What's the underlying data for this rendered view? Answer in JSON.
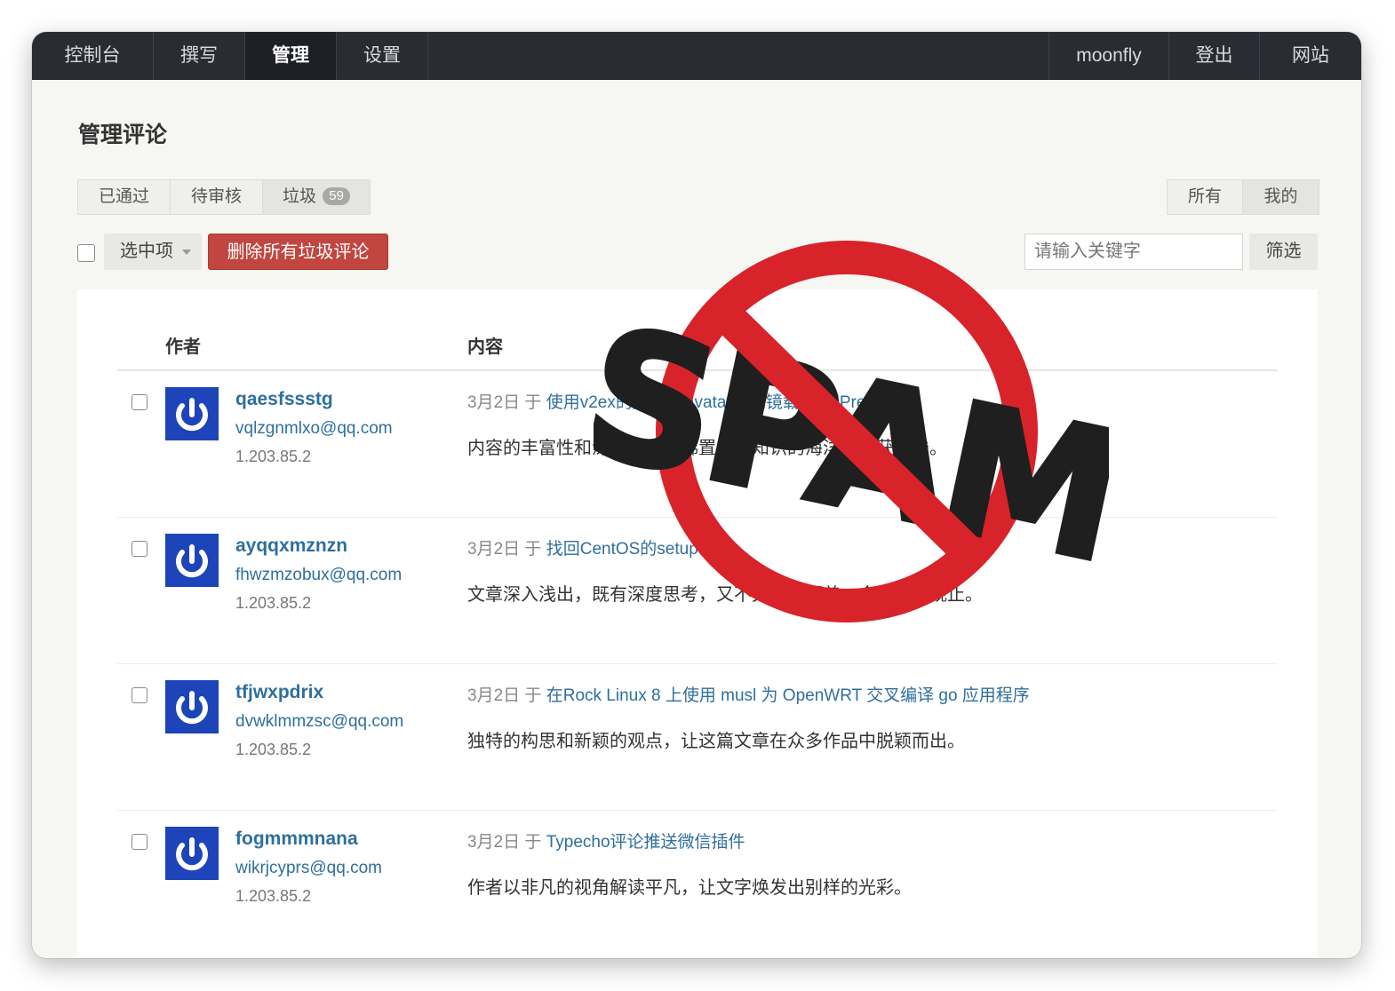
{
  "nav": {
    "left": [
      "控制台",
      "撰写",
      "管理",
      "设置"
    ],
    "active_index": 2,
    "right": [
      "moonfly",
      "登出",
      "网站"
    ]
  },
  "page_title": "管理评论",
  "status_tabs": {
    "approved": "已通过",
    "waiting": "待审核",
    "spam": "垃圾",
    "spam_count": "59"
  },
  "scope_tabs": [
    "所有",
    "我的"
  ],
  "toolbar": {
    "selected_label": "选中项",
    "delete_spam_label": "删除所有垃圾评论",
    "search_placeholder": "请输入关键字",
    "filter_label": "筛选"
  },
  "table": {
    "headers": {
      "author": "作者",
      "content": "内容"
    },
    "rows": [
      {
        "author": "qaesfssstg",
        "email": "vqlzgnmlxo@qq.com",
        "ip": "1.203.85.2",
        "date": "3月2日",
        "on": "于",
        "post": "使用v2ex的超快Gravatar头像镜载WordPress",
        "content": "内容的丰富性和深度让人仿佛置身于知识的海洋，收获匪浅。"
      },
      {
        "author": "ayqqxmznzn",
        "email": "fhwzmzobux@qq.com",
        "ip": "1.203.85.2",
        "date": "3月2日",
        "on": "于",
        "post": "找回CentOS的setup命令",
        "content": "文章深入浅出，既有深度思考，又不失广度覆盖，令人叹为观止。"
      },
      {
        "author": "tfjwxpdrix",
        "email": "dvwklmmzsc@qq.com",
        "ip": "1.203.85.2",
        "date": "3月2日",
        "on": "于",
        "post": "在Rock Linux 8 上使用 musl 为 OpenWRT 交叉编译 go 应用程序",
        "content": "独特的构思和新颖的观点，让这篇文章在众多作品中脱颖而出。"
      },
      {
        "author": "fogmmmnana",
        "email": "wikrjcyprs@qq.com",
        "ip": "1.203.85.2",
        "date": "3月2日",
        "on": "于",
        "post": "Typecho评论推送微信插件",
        "content": "作者以非凡的视角解读平凡，让文字焕发出别样的光彩。"
      }
    ]
  },
  "stamp": {
    "text": "SPAM",
    "icon": "no-spam-icon"
  },
  "colors": {
    "nav_bg": "#292d33",
    "link": "#2e6f9e",
    "danger": "#c0463f",
    "avatar": "#1d44b8",
    "stamp_red": "#d8232a"
  }
}
